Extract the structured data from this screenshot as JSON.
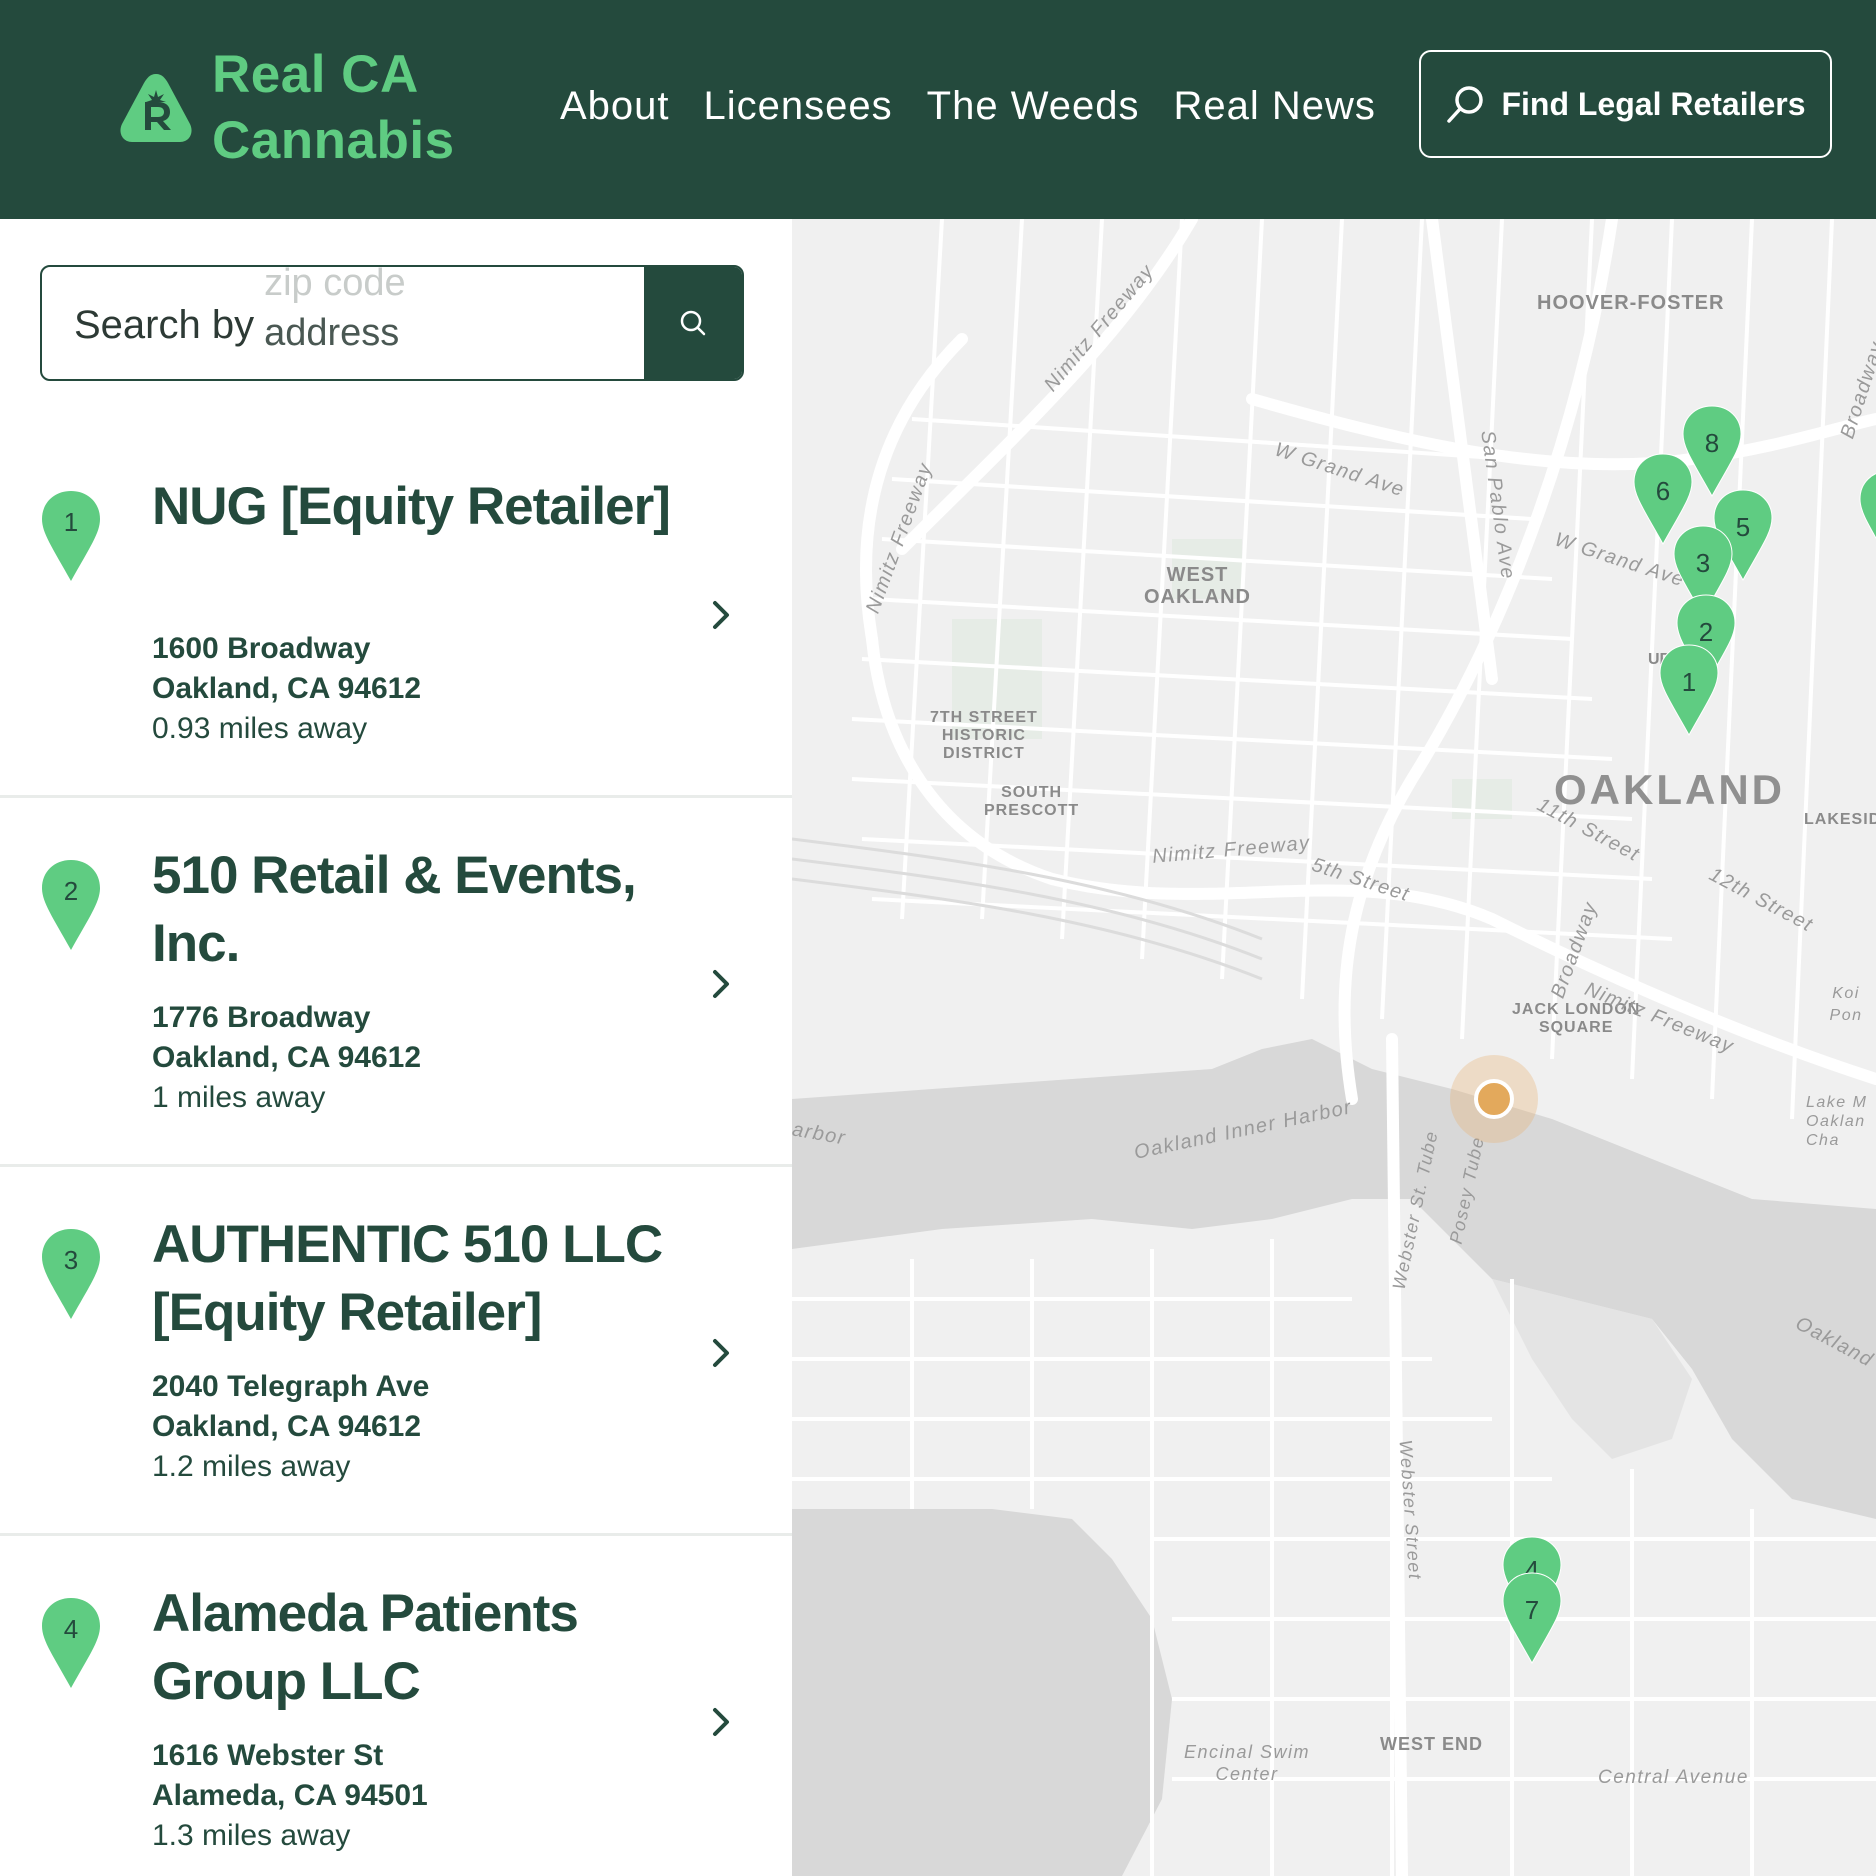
{
  "header": {
    "logo_line1": "Real CA",
    "logo_line2": "Cannabis",
    "nav": [
      "About",
      "Licensees",
      "The Weeds",
      "Real News"
    ],
    "find_button": "Find Legal Retailers"
  },
  "search": {
    "prefix": "Search by",
    "animated_prev": "zip code",
    "animated_current": "address"
  },
  "retailers": [
    {
      "num": "1",
      "name": "NUG [Equity Retailer]",
      "street": "1600 Broadway",
      "city": "Oakland, CA 94612",
      "distance": "0.93 miles away"
    },
    {
      "num": "2",
      "name": "510 Retail & Events, Inc.",
      "street": "1776 Broadway",
      "city": "Oakland, CA 94612",
      "distance": "1 miles away"
    },
    {
      "num": "3",
      "name": "AUTHENTIC 510 LLC [Equity Retailer]",
      "street": "2040 Telegraph Ave",
      "city": "Oakland, CA 94612",
      "distance": "1.2 miles away"
    },
    {
      "num": "4",
      "name": "Alameda Patients Group LLC",
      "street": "1616 Webster St",
      "city": "Alameda, CA 94501",
      "distance": "1.3 miles away"
    }
  ],
  "map": {
    "labels": {
      "hoover": "HOOVER-FOSTER",
      "west_oakland_1": "WEST",
      "west_oakland_2": "OAKLAND",
      "seventh_1": "7TH STREET",
      "seventh_2": "HISTORIC",
      "seventh_3": "DISTRICT",
      "south_1": "SOUTH",
      "south_2": "PRESCOTT",
      "oakland": "OAKLAND",
      "lakeside": "LAKESID",
      "jack_1": "JACK LONDON",
      "jack_2": "SQUARE",
      "west_end": "WEST END",
      "uptown": "UPTOWN",
      "nimitz1": "Nimitz Freeway",
      "nimitz2": "Nimitz Freeway",
      "nimitz3": "Nimitz Freeway",
      "nimitz4": "Nimitz Freeway",
      "wgrand1": "W Grand Ave",
      "wgrand2": "W Grand Ave",
      "sanpablo": "San Pablo Ave",
      "broadway_n": "Broadway",
      "broadway": "Broadway",
      "fifth": "5th Street",
      "eleventh": "11th Street",
      "twelfth": "12th Street",
      "koi": "Koi Pon",
      "inner_harbor": "Oakland Inner Harbor",
      "harbor_left": "arbor",
      "oakland_right": "Oakland",
      "lake_1": "Lake M",
      "lake_2": "Oaklan",
      "lake_3": "Cha",
      "webster_tube": "Webster St. Tube",
      "posey": "Posey Tube",
      "webster_street": "Webster Street",
      "encinal_1": "Encinal Swim",
      "encinal_2": "Center",
      "central": "Central Avenue"
    },
    "pins": [
      "8",
      "6",
      "5",
      "3",
      "2",
      "1",
      "4",
      "7"
    ]
  },
  "colors": {
    "header_bg": "#244a3d",
    "brand_green": "#5fcc82",
    "pin_green": "#5fcc82",
    "text_dark": "#244a3d",
    "user_location": "#e3a95c"
  },
  "icons": {
    "logo": "cannabis-leaf-r-icon",
    "search": "search-icon",
    "chevron": "chevron-right-icon",
    "pin": "map-pin-icon"
  }
}
